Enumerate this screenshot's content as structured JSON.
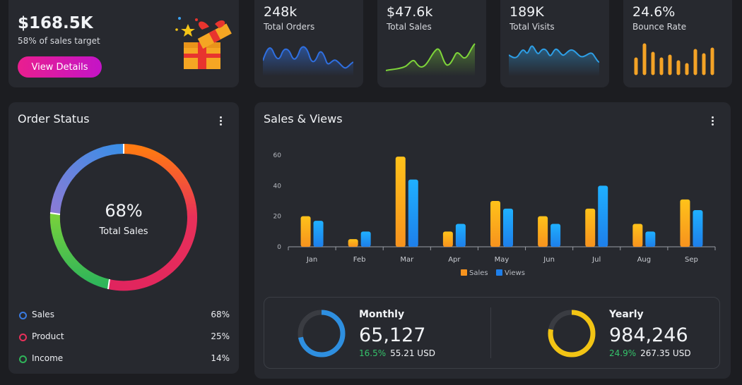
{
  "promo": {
    "amount": "$168.5K",
    "subtitle": "58% of sales target",
    "button_label": "View Details"
  },
  "kpis": [
    {
      "value": "248k",
      "label": "Total Orders",
      "color": "#2f6fe0"
    },
    {
      "value": "$47.6k",
      "label": "Total Sales",
      "color": "#7ed43a"
    },
    {
      "value": "189K",
      "label": "Total Visits",
      "color": "#2e9fe6"
    },
    {
      "value": "24.6%",
      "label": "Bounce Rate",
      "color": "#f4a326"
    }
  ],
  "order_status": {
    "title": "Order Status",
    "center_value": "68%",
    "center_label": "Total Sales",
    "legend": [
      {
        "name": "Sales",
        "percent": "68%",
        "color": "#3a7be0"
      },
      {
        "name": "Product",
        "percent": "25%",
        "color": "#e8305a"
      },
      {
        "name": "Income",
        "percent": "14%",
        "color": "#2fb55a"
      }
    ]
  },
  "sales_views": {
    "title": "Sales & Views",
    "summary": {
      "monthly": {
        "title": "Monthly",
        "value": "65,127",
        "percent": "16.5%",
        "usd": "55.21 USD",
        "color": "#2e8fe0",
        "fill": 0.72
      },
      "yearly": {
        "title": "Yearly",
        "value": "984,246",
        "percent": "24.9%",
        "usd": "267.35 USD",
        "color": "#f2c414",
        "fill": 0.78
      }
    }
  },
  "chart_data": {
    "type": "bar",
    "categories": [
      "Jan",
      "Feb",
      "Mar",
      "Apr",
      "May",
      "Jun",
      "Jul",
      "Aug",
      "Sep"
    ],
    "series": [
      {
        "name": "Sales",
        "values": [
          20,
          5,
          59,
          10,
          30,
          20,
          25,
          15,
          31
        ],
        "color": "#f7931e"
      },
      {
        "name": "Views",
        "values": [
          17,
          10,
          44,
          15,
          25,
          15,
          40,
          10,
          24
        ],
        "color": "#1e7fea"
      }
    ],
    "yticks": [
      "0",
      "20",
      "40",
      "60"
    ],
    "ylim": [
      0,
      60
    ],
    "legend_position": "bottom"
  }
}
